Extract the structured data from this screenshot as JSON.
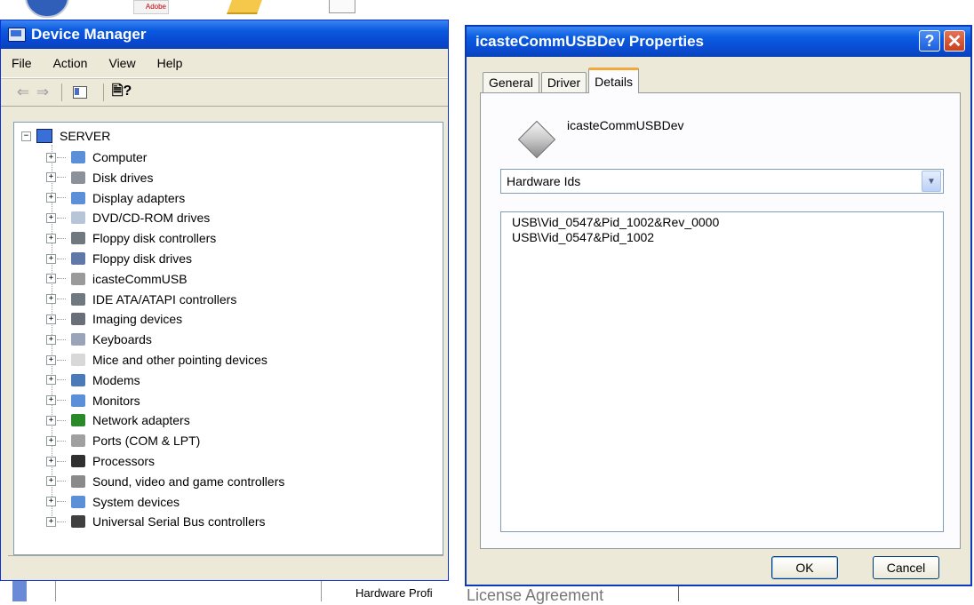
{
  "device_manager": {
    "title": "Device Manager",
    "menu": [
      "File",
      "Action",
      "View",
      "Help"
    ],
    "tree": {
      "root": "SERVER",
      "items": [
        {
          "label": "Computer",
          "icon": "computer-icon",
          "color": "#5b8fd8"
        },
        {
          "label": "Disk drives",
          "icon": "disk-drive-icon",
          "color": "#8c9098"
        },
        {
          "label": "Display adapters",
          "icon": "display-adapter-icon",
          "color": "#5b8fd8"
        },
        {
          "label": "DVD/CD-ROM drives",
          "icon": "dvd-drive-icon",
          "color": "#b8c4d8"
        },
        {
          "label": "Floppy disk controllers",
          "icon": "floppy-controller-icon",
          "color": "#707880"
        },
        {
          "label": "Floppy disk drives",
          "icon": "floppy-drive-icon",
          "color": "#6078a8"
        },
        {
          "label": "icasteCommUSB",
          "icon": "usb-device-icon",
          "color": "#9a9a9a"
        },
        {
          "label": "IDE ATA/ATAPI controllers",
          "icon": "ide-controller-icon",
          "color": "#707880"
        },
        {
          "label": "Imaging devices",
          "icon": "camera-icon",
          "color": "#6a6e78"
        },
        {
          "label": "Keyboards",
          "icon": "keyboard-icon",
          "color": "#9aa4b8"
        },
        {
          "label": "Mice and other pointing devices",
          "icon": "mouse-icon",
          "color": "#d8d8d8"
        },
        {
          "label": "Modems",
          "icon": "modem-icon",
          "color": "#4a7ab8"
        },
        {
          "label": "Monitors",
          "icon": "monitor-icon",
          "color": "#5b8fd8"
        },
        {
          "label": "Network adapters",
          "icon": "network-adapter-icon",
          "color": "#2a8a2a"
        },
        {
          "label": "Ports (COM & LPT)",
          "icon": "port-icon",
          "color": "#a0a0a0"
        },
        {
          "label": "Processors",
          "icon": "processor-icon",
          "color": "#303030"
        },
        {
          "label": "Sound, video and game controllers",
          "icon": "sound-icon",
          "color": "#8a8a8a"
        },
        {
          "label": "System devices",
          "icon": "system-devices-icon",
          "color": "#5b8fd8"
        },
        {
          "label": "Universal Serial Bus controllers",
          "icon": "usb-icon",
          "color": "#404040"
        }
      ]
    }
  },
  "properties_dialog": {
    "title": "icasteCommUSBDev Properties",
    "tabs": [
      "General",
      "Driver",
      "Details"
    ],
    "active_tab": "Details",
    "device_name": "icasteCommUSBDev",
    "property_selected": "Hardware Ids",
    "values": [
      "USB\\Vid_0547&Pid_1002&Rev_0000",
      "USB\\Vid_0547&Pid_1002"
    ],
    "buttons": {
      "ok": "OK",
      "cancel": "Cancel"
    }
  },
  "background": {
    "adobe_label": "Adobe",
    "hardware_profiles_text": "Hardware Profi",
    "license_text": "License Agreement"
  }
}
